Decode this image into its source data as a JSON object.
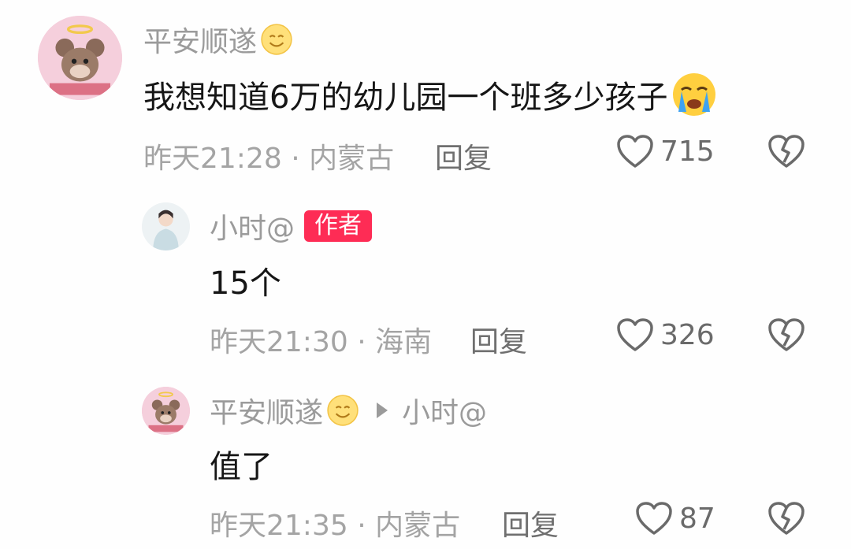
{
  "comments": [
    {
      "username": "平安顺遂",
      "username_emoji": "smiley-emoji",
      "text": "我想知道6万的幼儿园一个班多少孩子",
      "text_emoji": "crying-emoji",
      "meta": "昨天21:28 · 内蒙古",
      "reply_label": "回复",
      "likes": "715"
    },
    {
      "username": "小时@",
      "badge": "作者",
      "text": "15个",
      "meta": "昨天21:30 · 海南",
      "reply_label": "回复",
      "likes": "326"
    },
    {
      "username": "平安顺遂",
      "username_emoji": "smiley-emoji",
      "reply_to": "小时@",
      "text": "值了",
      "meta": "昨天21:35 · 内蒙古",
      "reply_label": "回复",
      "likes": "87"
    }
  ],
  "icons": {
    "like": "heart-outline-icon",
    "dislike": "broken-heart-icon",
    "reply_arrow": "play-triangle-icon"
  },
  "colors": {
    "author_badge": "#fe2c55",
    "username": "#9b9b9b",
    "text": "#161616",
    "meta": "#a4a4a4"
  }
}
